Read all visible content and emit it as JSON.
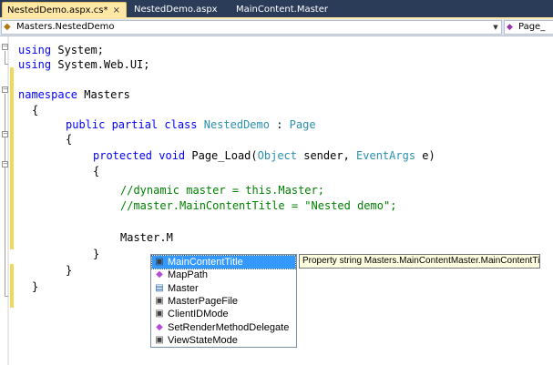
{
  "tabs": [
    {
      "label": "NestedDemo.aspx.cs*",
      "active": true
    },
    {
      "label": "NestedDemo.aspx",
      "active": false
    },
    {
      "label": "MainContent.Master",
      "active": false
    }
  ],
  "tab_close_glyph": "×",
  "navbar": {
    "class_combo": "Masters.NestedDemo",
    "member_combo": "Page_"
  },
  "code_lines": [
    {
      "parts": [
        [
          "kw",
          "using"
        ],
        [
          "",
          " System;"
        ]
      ]
    },
    {
      "parts": [
        [
          "kw",
          "using"
        ],
        [
          "",
          " System.Web.UI;"
        ]
      ]
    },
    {
      "parts": []
    },
    {
      "parts": [
        [
          "kw",
          "namespace"
        ],
        [
          "",
          " Masters"
        ]
      ]
    },
    {
      "parts": [
        [
          "",
          "{"
        ]
      ]
    },
    {
      "parts": [
        [
          "kw",
          "public partial class"
        ],
        [
          "",
          " "
        ],
        [
          "ty",
          "NestedDemo"
        ],
        [
          "",
          " : "
        ],
        [
          "ty",
          "Page"
        ]
      ]
    },
    {
      "parts": [
        [
          "",
          "{"
        ]
      ]
    },
    {
      "parts": [
        [
          "kw",
          "protected void"
        ],
        [
          "",
          " Page_Load("
        ],
        [
          "ty",
          "Object"
        ],
        [
          "",
          " sender, "
        ],
        [
          "ty",
          "EventArgs"
        ],
        [
          "",
          " e)"
        ]
      ]
    },
    {
      "parts": [
        [
          "",
          "{"
        ]
      ]
    },
    {
      "parts": [
        [
          "cm",
          "//dynamic master = this.Master;"
        ]
      ]
    },
    {
      "parts": [
        [
          "cm",
          "//master.MainContentTitle = \"Nested demo\";"
        ]
      ]
    },
    {
      "parts": []
    },
    {
      "parts": [
        [
          "",
          "Master.M"
        ]
      ]
    },
    {
      "parts": [
        [
          "",
          "}"
        ]
      ]
    },
    {
      "parts": [
        [
          "",
          "}"
        ]
      ]
    },
    {
      "parts": [
        [
          "",
          "}"
        ]
      ]
    }
  ],
  "completion": {
    "items": [
      {
        "label": "MainContentTitle",
        "icon": "property-icon",
        "selected": true
      },
      {
        "label": "MapPath",
        "icon": "method-icon",
        "selected": false
      },
      {
        "label": "Master",
        "icon": "field-icon",
        "selected": false
      },
      {
        "label": "MasterPageFile",
        "icon": "property-icon",
        "selected": false
      },
      {
        "label": "ClientIDMode",
        "icon": "property-icon",
        "selected": false
      },
      {
        "label": "SetRenderMethodDelegate",
        "icon": "method-icon",
        "selected": false
      },
      {
        "label": "ViewStateMode",
        "icon": "property-icon",
        "selected": false
      }
    ],
    "tooltip": "Property string Masters.MainContentMaster.MainContentTitle"
  },
  "colors": {
    "tabstrip": "#2b3c59",
    "active_tab": "#ffe8a6",
    "keyword": "#0000ff",
    "type": "#2b91af",
    "comment": "#008000",
    "selection": "#3399ff",
    "tooltip_bg": "#ffffe1"
  }
}
